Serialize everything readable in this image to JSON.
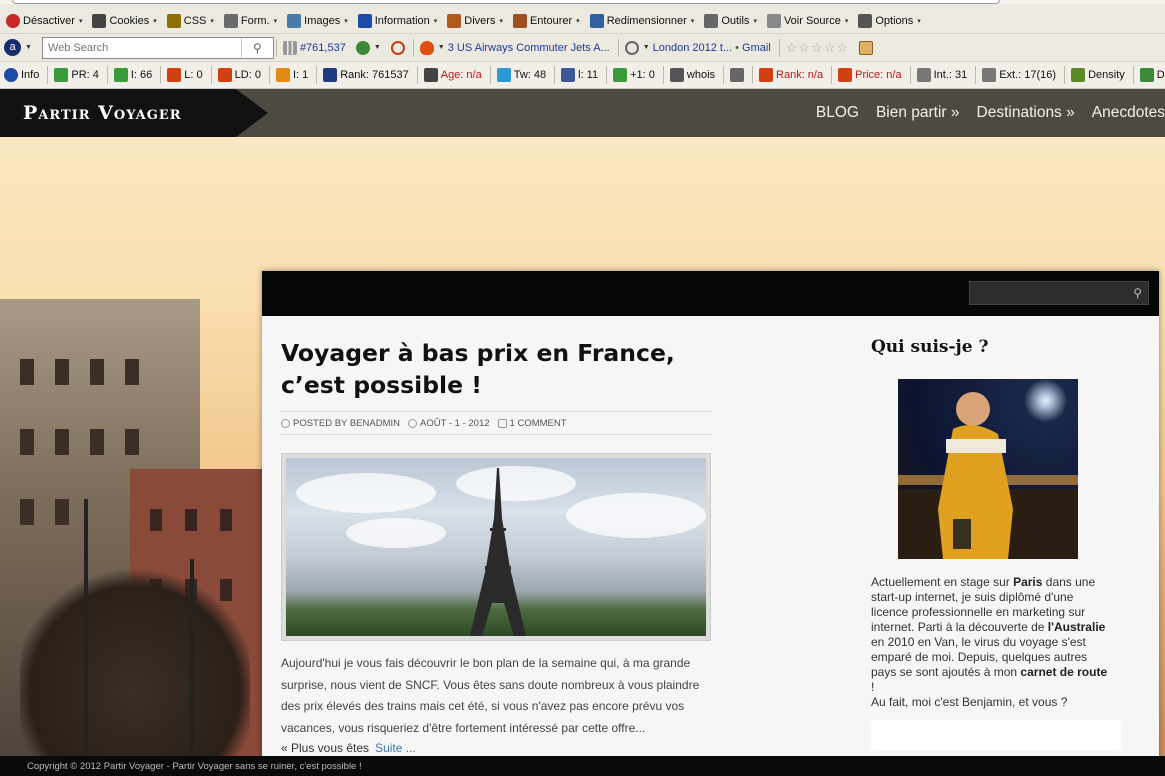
{
  "toolbar1": {
    "items": [
      {
        "label": "Désactiver",
        "icon": "no-entry-icon",
        "color": "#c62828"
      },
      {
        "label": "Cookies",
        "icon": "person-icon",
        "color": "#444444"
      },
      {
        "label": "CSS",
        "icon": "pencil-icon",
        "color": "#8d6e00"
      },
      {
        "label": "Form.",
        "icon": "form-icon",
        "color": "#6a6a6a"
      },
      {
        "label": "Images",
        "icon": "image-icon",
        "color": "#4a7aa8"
      },
      {
        "label": "Information",
        "icon": "info-icon",
        "color": "#1e4aa8"
      },
      {
        "label": "Divers",
        "icon": "toolbox-icon",
        "color": "#b05a20"
      },
      {
        "label": "Entourer",
        "icon": "pen-icon",
        "color": "#a05020"
      },
      {
        "label": "Redimensionner",
        "icon": "resize-icon",
        "color": "#3060a0"
      },
      {
        "label": "Outils",
        "icon": "tools-icon",
        "color": "#666666"
      },
      {
        "label": "Voir Source",
        "icon": "document-icon",
        "color": "#888888"
      },
      {
        "label": "Options",
        "icon": "options-icon",
        "color": "#555555"
      }
    ]
  },
  "toolbar2": {
    "search_placeholder": "Web Search",
    "alexa_rank": "#761,537",
    "news_link": "3 US Airways Commuter Jets A...",
    "news2_link": "London 2012 t...",
    "gmail_label": "Gmail",
    "bullet": "•"
  },
  "toolbar3": {
    "items": [
      {
        "label": "Info",
        "icon": "info-icon",
        "color": "#1e4aa8",
        "red": false
      },
      {
        "label": "PR: 4",
        "icon": "google-icon",
        "color": "#3a9a3a",
        "red": false
      },
      {
        "label": "I: 66",
        "icon": "google-icon",
        "color": "#3a9a3a",
        "red": false
      },
      {
        "label": "L: 0",
        "icon": "yahoo-icon",
        "color": "#d04010",
        "red": false
      },
      {
        "label": "LD: 0",
        "icon": "yahoo-icon",
        "color": "#d04010",
        "red": false
      },
      {
        "label": "I: 1",
        "icon": "bing-icon",
        "color": "#e08a10",
        "red": false
      },
      {
        "label": "Rank: 761537",
        "icon": "alexa-icon",
        "color": "#203a80",
        "red": false
      },
      {
        "label": "Age: n/a",
        "icon": "archive-icon",
        "color": "#444444",
        "red": true
      },
      {
        "label": "Tw: 48",
        "icon": "twitter-icon",
        "color": "#2a9ad8",
        "red": false
      },
      {
        "label": "l: 11",
        "icon": "facebook-icon",
        "color": "#3b5998",
        "red": false
      },
      {
        "label": "+1: 0",
        "icon": "google-plus-icon",
        "color": "#3a9a3a",
        "red": false
      },
      {
        "label": "whois",
        "icon": "fingerprint-icon",
        "color": "#555555",
        "red": false
      },
      {
        "label": "",
        "icon": "source-icon",
        "color": "#666666",
        "red": false
      },
      {
        "label": "Rank: n/a",
        "icon": "semrush-icon",
        "color": "#d04010",
        "red": true
      },
      {
        "label": "Price: n/a",
        "icon": "semrush-icon",
        "color": "#d04010",
        "red": true
      },
      {
        "label": "Int.: 31",
        "icon": "hand-icon",
        "color": "#777777",
        "red": false
      },
      {
        "label": "Ext.: 17(16)",
        "icon": "hand-icon",
        "color": "#777777",
        "red": false
      },
      {
        "label": "Density",
        "icon": "bar-chart-icon",
        "color": "#5a8a2a",
        "red": false
      },
      {
        "label": "Diag",
        "icon": "pulse-icon",
        "color": "#3a8a3a",
        "red": false
      }
    ]
  },
  "site": {
    "logo": "Partir Voyager",
    "nav": [
      "BLOG",
      "Bien partir »",
      "Destinations »",
      "Anecdotes"
    ],
    "post": {
      "title": "Voyager à bas prix en France, c’est possible !",
      "author": "POSTED BY BENADMIN",
      "date": "AOÛT - 1 - 2012",
      "comments": "1 COMMENT",
      "excerpt": "Aujourd'hui je vous fais découvrir le bon plan de la semaine qui, à ma grande surprise, nous vient de SNCF. Vous êtes sans doute nombreux à vous plaindre des prix élevés des trains mais cet été, si vous n'avez pas encore prévu vos vacances, vous risqueriez d'être fortement intéressé par cette offre...",
      "more_prefix": "« Plus vous êtes",
      "more_link": "Suite ..."
    },
    "sidebar": {
      "title": "Qui suis-je ?",
      "about_1": "Actuellement en stage sur ",
      "about_paris": "Paris",
      "about_2": " dans une start-up internet, je suis diplômé d'une licence professionnelle en marketing sur internet. Parti à la découverte de ",
      "about_australie": "l'Australie",
      "about_3": " en 2010 en Van, le virus du voyage s'est emparé de moi. Depuis, quelques autres pays se sont ajoutés à mon ",
      "about_carnet": "carnet de route",
      "about_4": " !",
      "about_5": "Au fait, moi c'est Benjamin, et vous ?"
    },
    "footer": "Copyright © 2012 Partir Voyager - Partir Voyager sans se ruiner, c'est possible !"
  }
}
